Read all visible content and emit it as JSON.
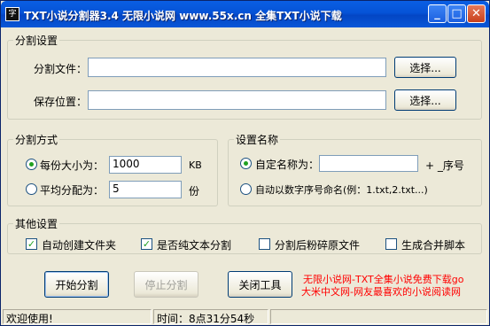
{
  "window": {
    "title": "TXT小说分割器3.4   无限小说网 www.55x.cn 全集TXT小说下载",
    "app_icon_glyph": "字"
  },
  "split_settings": {
    "legend": "分割设置",
    "file_label": "分割文件：",
    "file_value": "",
    "save_label": "保存位置：",
    "save_value": "",
    "browse_label": "选择..."
  },
  "split_mode": {
    "legend": "分割方式",
    "option_size_label": "每份大小为：",
    "size_value": "1000",
    "size_unit": "KB",
    "option_avg_label": "平均分配为：",
    "avg_value": "5",
    "avg_unit": "份",
    "selected": "size"
  },
  "naming": {
    "legend": "设置名称",
    "option_custom_label": "自定名称为：",
    "custom_value": "",
    "custom_suffix": "+ _序号",
    "option_number_label": "自动以数字序号命名(例：1.txt,2.txt...)",
    "selected": "custom"
  },
  "other": {
    "legend": "其他设置",
    "options": [
      {
        "label": "自动创建文件夹",
        "checked": true
      },
      {
        "label": "是否纯文本分割",
        "checked": true
      },
      {
        "label": "分割后粉碎原文件",
        "checked": false
      },
      {
        "label": "生成合并脚本",
        "checked": false
      }
    ]
  },
  "actions": {
    "start_label": "开始分割",
    "stop_label": "停止分割",
    "close_label": "关闭工具"
  },
  "promo": {
    "line1": "无限小说网-TXT全集小说免费下载go",
    "line2": "大米中文网-网友最喜欢的小说阅读网"
  },
  "status": {
    "message": "欢迎使用!",
    "time": "时间：8点31分54秒",
    "extra": ""
  },
  "colors": {
    "titlebar": "#0552d6",
    "promo": "#ff0000",
    "dialog_bg": "#ece9d8"
  }
}
